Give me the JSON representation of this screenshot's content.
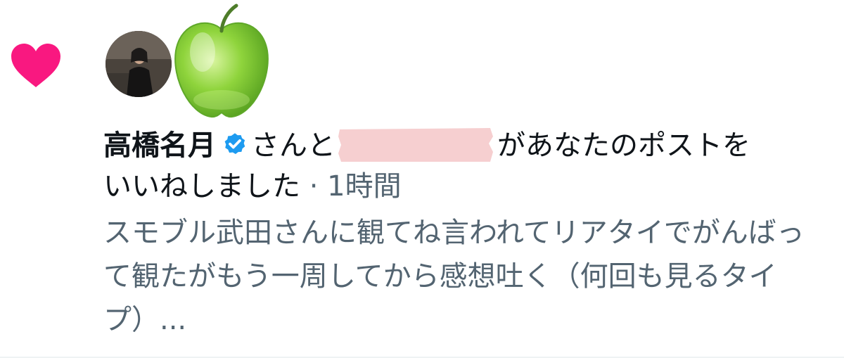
{
  "notification": {
    "type_icon": "heart-icon",
    "avatars": [
      "avatar-photo",
      "green-apple-avatar"
    ],
    "actor_name": "高橋名月",
    "verified_icon": "verified-badge-icon",
    "connector": "さんと",
    "redacted": true,
    "action_line1": "があなたのポストを",
    "action_line2": "いいねしました",
    "separator": " · ",
    "time": "1時間",
    "preview": "スモブル武田さんに観てね言われてリアタイでがんばって観たがもう一周してから感想吐く（何回も見るタイプ）..."
  },
  "colors": {
    "heart": "#f91880",
    "verified": "#1d9bf0",
    "text": "#0f1419",
    "secondary": "#536471",
    "redaction": "#f6cfd0"
  }
}
